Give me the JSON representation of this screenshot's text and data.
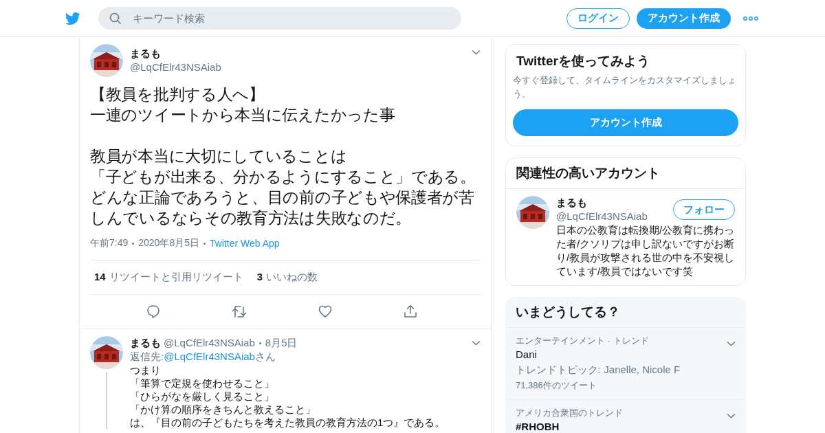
{
  "header": {
    "search": {
      "placeholder": "キーワード検索"
    },
    "login_button": "ログイン",
    "signup_button": "アカウント作成"
  },
  "tweet": {
    "name": "まるも",
    "handle": "@LqCfElr43NSAiab",
    "paragraphs": [
      [
        "【教員を批判する人へ】",
        "一連のツイートから本当に伝えたかった事"
      ],
      [
        "教員が本当に大切にしていることは",
        "「子どもが出来る、分かるようにすること」である。",
        "どんな正論であろうと、目の前の子どもや保護者が苦しんでいるならその教育方法は失敗なのだ。"
      ]
    ],
    "time": "午前7:49",
    "date": "2020年8月5日",
    "source": "Twitter Web App",
    "stats": [
      {
        "count": "14",
        "label": "リツイートと引用リツイート"
      },
      {
        "count": "3",
        "label": "いいねの数"
      }
    ]
  },
  "reply": {
    "name": "まるも",
    "handle": "@LqCfElr43NSAiab",
    "date": "8月5日",
    "reply_to_label": "返信先:",
    "reply_to_handle": "@LqCfElr43NSAiab",
    "reply_to_suffix": "さん",
    "lines": [
      "つまり",
      "「筆算で定規を使わせること」",
      "「ひらがなを厳しく見ること」",
      "「かけ算の順序をきちんと教えること」",
      "は、『目の前の子どもたちを考えた教員の教育方法の1つ』である。"
    ]
  },
  "signup_card": {
    "title": "Twitterを使ってみよう",
    "text": "今すぐ登録して、タイムラインをカスタマイズしましょう。",
    "button": "アカウント作成"
  },
  "related_card": {
    "title": "関連性の高いアカウント",
    "accounts": [
      {
        "name": "まるも",
        "handle": "@LqCfElr43NSAiab",
        "button": "フォロー",
        "bio": "日本の公教育は転換期/公教育に携わった者/クソリプは申し訳ないですがお断り/教員が攻撃される世の中を不安視しています/教員ではないです笑"
      }
    ]
  },
  "trends_card": {
    "title": "いまどうしてる？",
    "trends": [
      {
        "context": "エンターテインメント · トレンド",
        "name": "Dani",
        "topics": "トレンドトピック: Janelle, Nicole F",
        "count": "71,386件のツイート"
      },
      {
        "context": "アメリカ合衆国のトレンド",
        "name": "#RHOBH"
      }
    ]
  }
}
